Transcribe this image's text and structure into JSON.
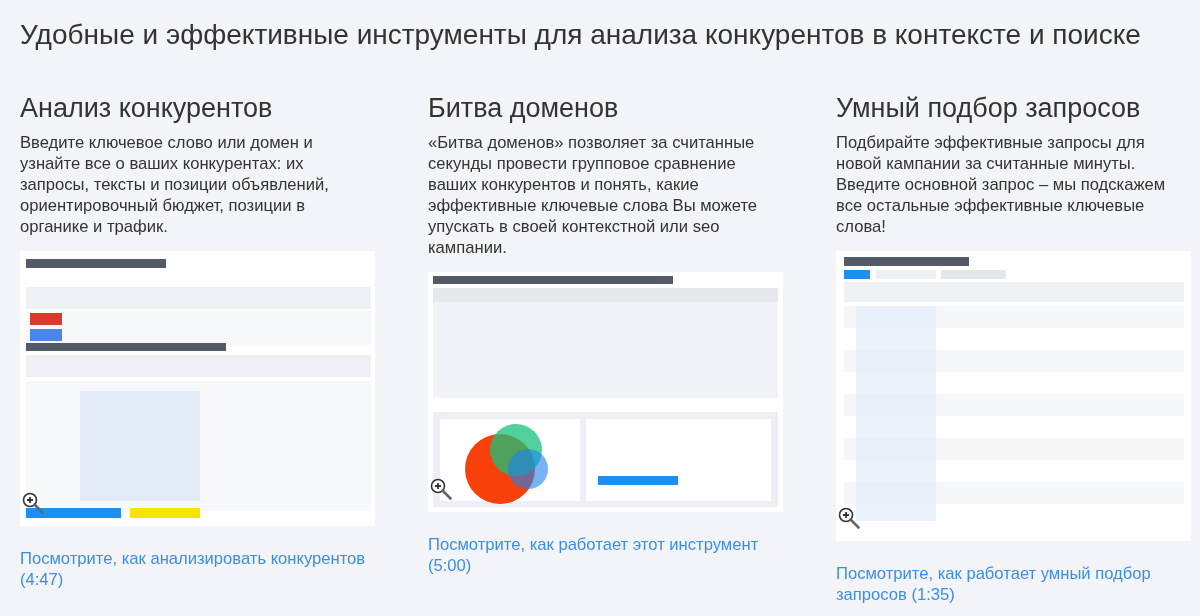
{
  "title": "Удобные и эффективные инструменты для анализа конкурентов в контексте и поиске",
  "tools": [
    {
      "heading": "Анализ конкурентов",
      "description": "Введите ключевое слово или домен и узнайте все о ваших конкурентах: их запросы, тексты и позиции объявлений, ориентировочный бюджет, позиции в органике и трафик.",
      "link": "Посмотрите, как анализировать конкурентов (4:47)"
    },
    {
      "heading": "Битва доменов",
      "description": "«Битва доменов» позволяет за считанные секунды провести групповое сравнение ваших конкурентов и понять, какие эффективные ключевые слова Вы можете упускать в своей контекстной или seo кампании.",
      "link": "Посмотрите, как работает этот инструмент (5:00)"
    },
    {
      "heading": "Умный подбор запросов",
      "description": "Подбирайте эффективные запросы для новой кампании за считанные минуты. Введите основной запрос – мы подскажем все остальные эффективные ключевые слова!",
      "link": "Посмотрите, как работает умный подбор запросов (1:35)"
    }
  ]
}
